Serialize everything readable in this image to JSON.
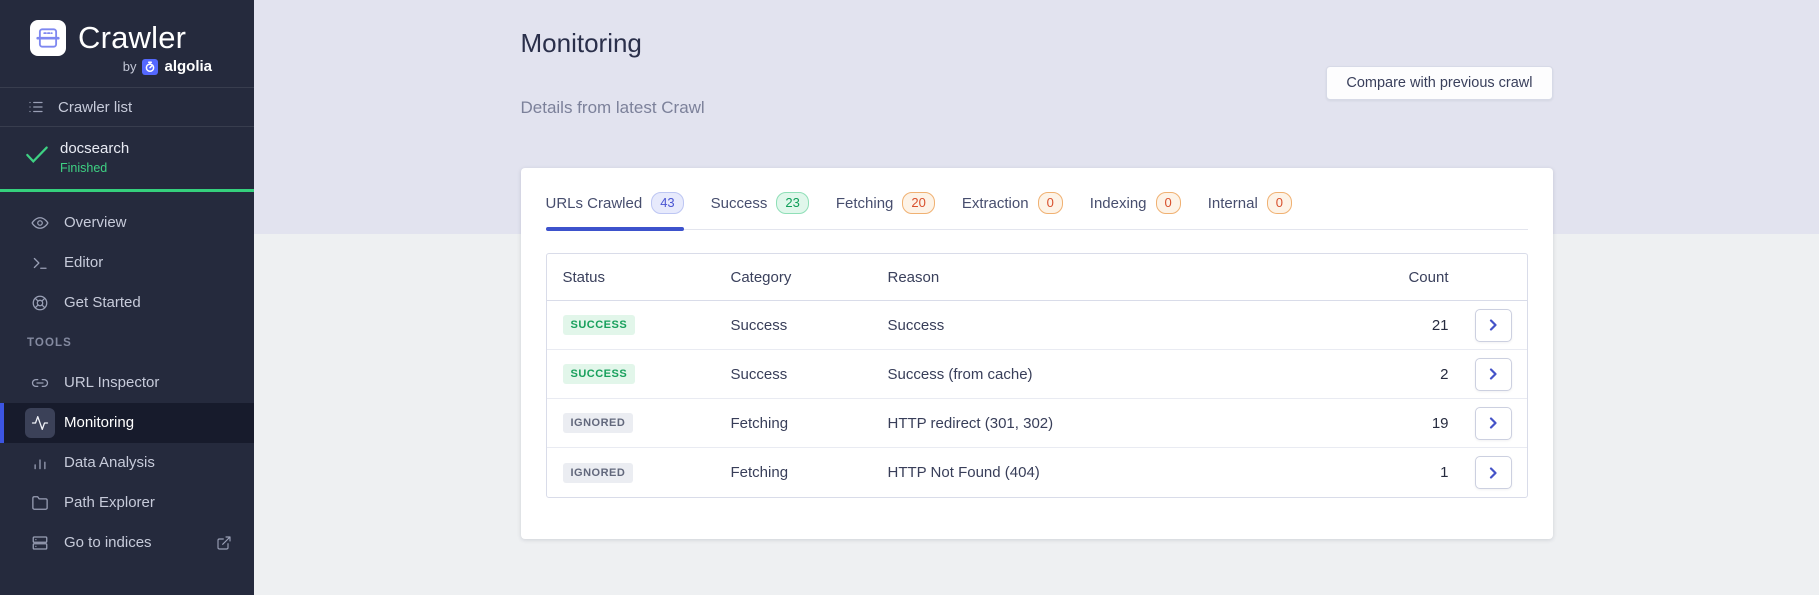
{
  "colors": {
    "sidebar_bg": "#252a3d",
    "accent_blue": "#3d52cc",
    "success_green": "#35d07d",
    "badge_orange_text": "#d8502d",
    "top_band_bg": "#e2e3ef",
    "content_bg": "#eef0f2"
  },
  "sidebar": {
    "logo": {
      "title": "Crawler",
      "by": "by",
      "brand": "algolia"
    },
    "crawler_list_label": "Crawler list",
    "crawl": {
      "name": "docsearch",
      "status": "Finished"
    },
    "nav_items": [
      {
        "label": "Overview"
      },
      {
        "label": "Editor"
      },
      {
        "label": "Get Started"
      }
    ],
    "tools_header": "TOOLS",
    "tools_items": [
      {
        "label": "URL Inspector"
      },
      {
        "label": "Monitoring",
        "active": true
      },
      {
        "label": "Data Analysis"
      },
      {
        "label": "Path Explorer"
      },
      {
        "label": "Go to indices"
      }
    ]
  },
  "header": {
    "title": "Monitoring",
    "subtitle": "Details from latest Crawl",
    "compare_button": "Compare with previous crawl"
  },
  "tabs": [
    {
      "label": "URLs Crawled",
      "count": "43",
      "style": "blue",
      "active": true
    },
    {
      "label": "Success",
      "count": "23",
      "style": "green"
    },
    {
      "label": "Fetching",
      "count": "20",
      "style": "orange"
    },
    {
      "label": "Extraction",
      "count": "0",
      "style": "orange"
    },
    {
      "label": "Indexing",
      "count": "0",
      "style": "orange"
    },
    {
      "label": "Internal",
      "count": "0",
      "style": "orange"
    }
  ],
  "table": {
    "columns": [
      "Status",
      "Category",
      "Reason",
      "Count"
    ],
    "rows": [
      {
        "status": "SUCCESS",
        "category": "Success",
        "reason": "Success",
        "count": "21"
      },
      {
        "status": "SUCCESS",
        "category": "Success",
        "reason": "Success (from cache)",
        "count": "2"
      },
      {
        "status": "IGNORED",
        "category": "Fetching",
        "reason": "HTTP redirect (301, 302)",
        "count": "19"
      },
      {
        "status": "IGNORED",
        "category": "Fetching",
        "reason": "HTTP Not Found (404)",
        "count": "1"
      }
    ]
  }
}
